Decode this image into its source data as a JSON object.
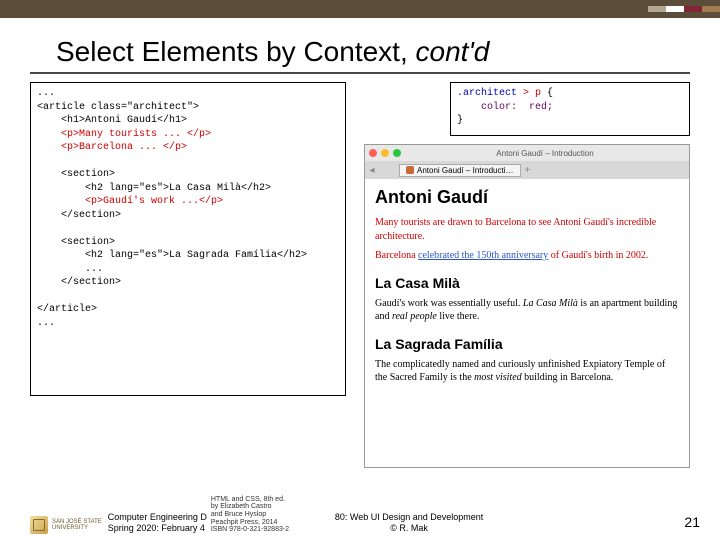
{
  "stripes": true,
  "title": {
    "main": "Select Elements by Context, ",
    "suffix": "cont'd"
  },
  "code_left": [
    {
      "cls": "c-black",
      "t": "..."
    },
    {
      "cls": "c-black",
      "t": "<article class=\"architect\">"
    },
    {
      "cls": "c-black",
      "t": "    <h1>Antoni Gaudí</h1>"
    },
    {
      "cls": "c-red",
      "t": "    <p>Many tourists ... </p>"
    },
    {
      "cls": "c-red",
      "t": "    <p>Barcelona ... </p>"
    },
    {
      "cls": "c-black",
      "t": ""
    },
    {
      "cls": "c-black",
      "t": "    <section>"
    },
    {
      "cls": "c-black",
      "t": "        <h2 lang=\"es\">La Casa Milà</h2>"
    },
    {
      "cls": "c-red",
      "t": "        <p>Gaudí's work ...</p>"
    },
    {
      "cls": "c-black",
      "t": "    </section>"
    },
    {
      "cls": "c-black",
      "t": ""
    },
    {
      "cls": "c-black",
      "t": "    <section>"
    },
    {
      "cls": "c-black",
      "t": "        <h2 lang=\"es\">La Sagrada Família</h2>"
    },
    {
      "cls": "c-black",
      "t": "        ..."
    },
    {
      "cls": "c-black",
      "t": "    </section>"
    },
    {
      "cls": "c-black",
      "t": ""
    },
    {
      "cls": "c-black",
      "t": "</article>"
    },
    {
      "cls": "c-black",
      "t": "..."
    }
  ],
  "code_right": [
    {
      "t": ".architect ",
      "sel": "> p",
      "rest": " {"
    },
    {
      "t": "    color:  red;"
    },
    {
      "t": "}"
    }
  ],
  "browser": {
    "window_title": "Antoni Gaudí – Introduction",
    "tab_label": "Antoni Gaudí – Introducti…",
    "tab_plus": "+",
    "h1": "Antoni Gaudí",
    "p1_html": "Many tourists are drawn to Barcelona to see Antoni Gaudí's incredible architecture.",
    "p2_pre": "Barcelona ",
    "p2_link": "celebrated the 150th anniversary",
    "p2_post": " of Gaudí's birth in 2002.",
    "h2a": "La Casa Milà",
    "p3_html": "Gaudí's work was essentially useful. <span class=\"ital\">La Casa Milà</span> is an apartment building and <span class=\"ital\">real people</span> live there.",
    "h2b": "La Sagrada Família",
    "p4_html": "The complicatedly named and curiously unfinished Expiatory Temple of the Sacred Family is the <span class=\"ital\">most visited</span> building in Barcelona."
  },
  "footer": {
    "sjsu_line1": "SAN JOSÉ STATE",
    "sjsu_line2": "UNIVERSITY",
    "dept_line1": "Computer Engineering D",
    "dept_line2": "Spring 2020: February 4",
    "book_l1": "HTML and CSS, 8th ed.",
    "book_l2": "by Elizabeth Castro",
    "book_l3": "and Bruce Hyslop",
    "book_l4": "Peachpit Press, 2014",
    "book_l5": "ISBN 978-0-321-92883-2",
    "course_l1": "80: Web UI Design and Development",
    "course_l2": "© R. Mak"
  },
  "page_number": "21"
}
